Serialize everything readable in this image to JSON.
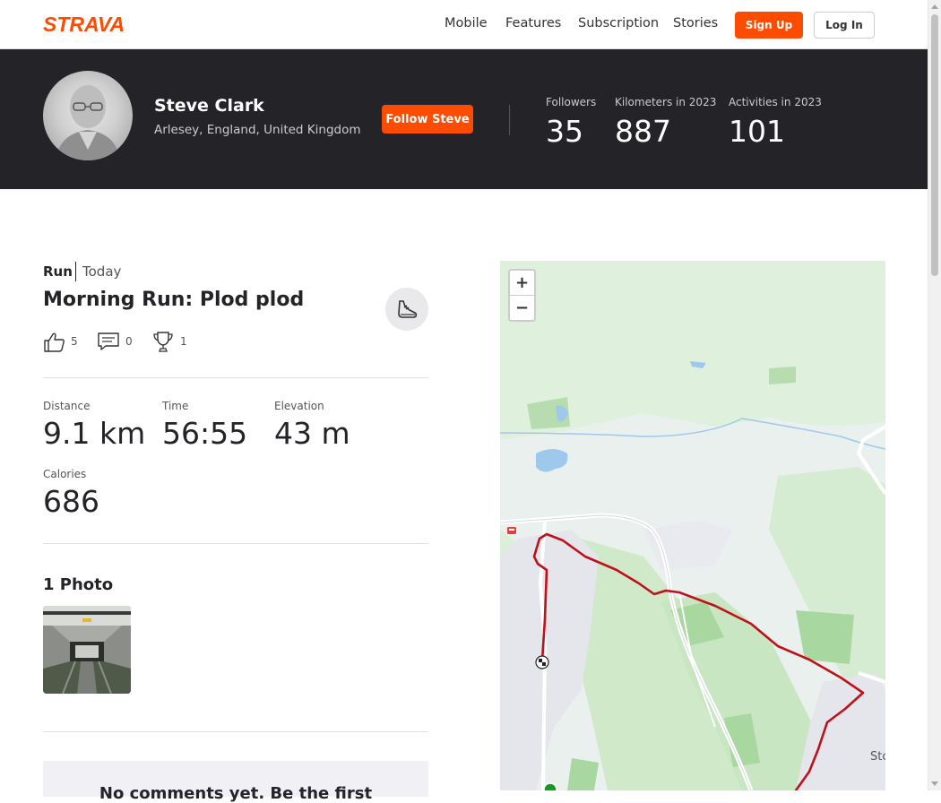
{
  "nav": {
    "logo": "STRAVA",
    "links": [
      "Mobile",
      "Features",
      "Subscription",
      "Stories"
    ],
    "signup": "Sign Up",
    "login": "Log In"
  },
  "athlete": {
    "name": "Steve Clark",
    "location": "Arlesey, England, United Kingdom",
    "follow_label": "Follow Steve",
    "stats": [
      {
        "label": "Followers",
        "value": "35"
      },
      {
        "label": "Kilometers in 2023",
        "value": "887"
      },
      {
        "label": "Activities in 2023",
        "value": "101"
      }
    ]
  },
  "activity": {
    "type": "Run",
    "date": "Today",
    "title": "Morning Run: Plod plod",
    "kudos": "5",
    "comments": "0",
    "achievements": "1",
    "metrics": {
      "distance_label": "Distance",
      "distance": "9.1 km",
      "time_label": "Time",
      "time": "56:55",
      "elevation_label": "Elevation",
      "elevation": "43 m",
      "calories_label": "Calories",
      "calories": "686"
    },
    "photos_heading": "1 Photo",
    "comments_prompt": "No comments yet. Be the first"
  },
  "map": {
    "zoom_in": "+",
    "zoom_out": "−",
    "place_label": "Sto",
    "route_color": "#c0101a"
  }
}
